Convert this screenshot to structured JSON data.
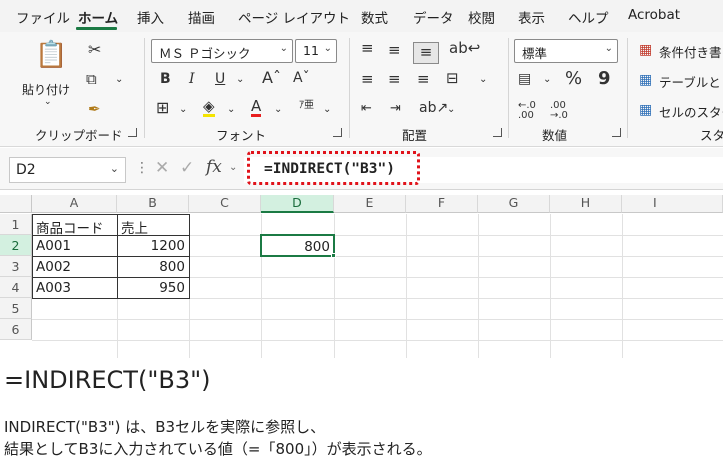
{
  "menu": {
    "tabs": [
      "ファイル",
      "ホーム",
      "挿入",
      "描画",
      "ページ レイアウト",
      "数式",
      "データ",
      "校閲",
      "表示",
      "ヘルプ",
      "Acrobat"
    ],
    "active": "ホーム"
  },
  "ribbon": {
    "clipboard": {
      "paste_label": "貼り付け",
      "group_label": "クリップボード"
    },
    "font": {
      "name": "ＭＳ Ｐゴシック",
      "size": "11",
      "group_label": "フォント"
    },
    "alignment": {
      "group_label": "配置"
    },
    "number": {
      "format": "標準",
      "percent": "%",
      "comma": "9",
      "group_label": "数値"
    },
    "styles": {
      "conditional": "条件付き書",
      "table": "テーブルとし",
      "cell": "セルのスター",
      "group_label": "スタ"
    }
  },
  "formula_bar": {
    "name_box": "D2",
    "fx_label": "fx",
    "formula": "=INDIRECT(\"B3\")"
  },
  "sheet": {
    "columns": [
      "A",
      "B",
      "C",
      "D",
      "E",
      "F",
      "G",
      "H",
      "I"
    ],
    "rows": [
      "1",
      "2",
      "3",
      "4",
      "5",
      "6"
    ],
    "selected_cell": "D2",
    "cells": {
      "A1": "商品コード",
      "B1": "売上",
      "A2": "A001",
      "B2": "1200",
      "A3": "A002",
      "B3": "800",
      "A4": "A003",
      "B4": "950",
      "D2": "800"
    }
  },
  "caption": {
    "formula": "=INDIRECT(\"B3\")",
    "line1": "INDIRECT(\"B3\") は、B3セルを実際に参照し、",
    "line2": "結果としてB3に入力されている値（=「800」）が表示される。"
  },
  "colors": {
    "excel_green": "#1b7a44",
    "highlight_red": "#e0121a",
    "selected_header": "#d3f0e0"
  }
}
